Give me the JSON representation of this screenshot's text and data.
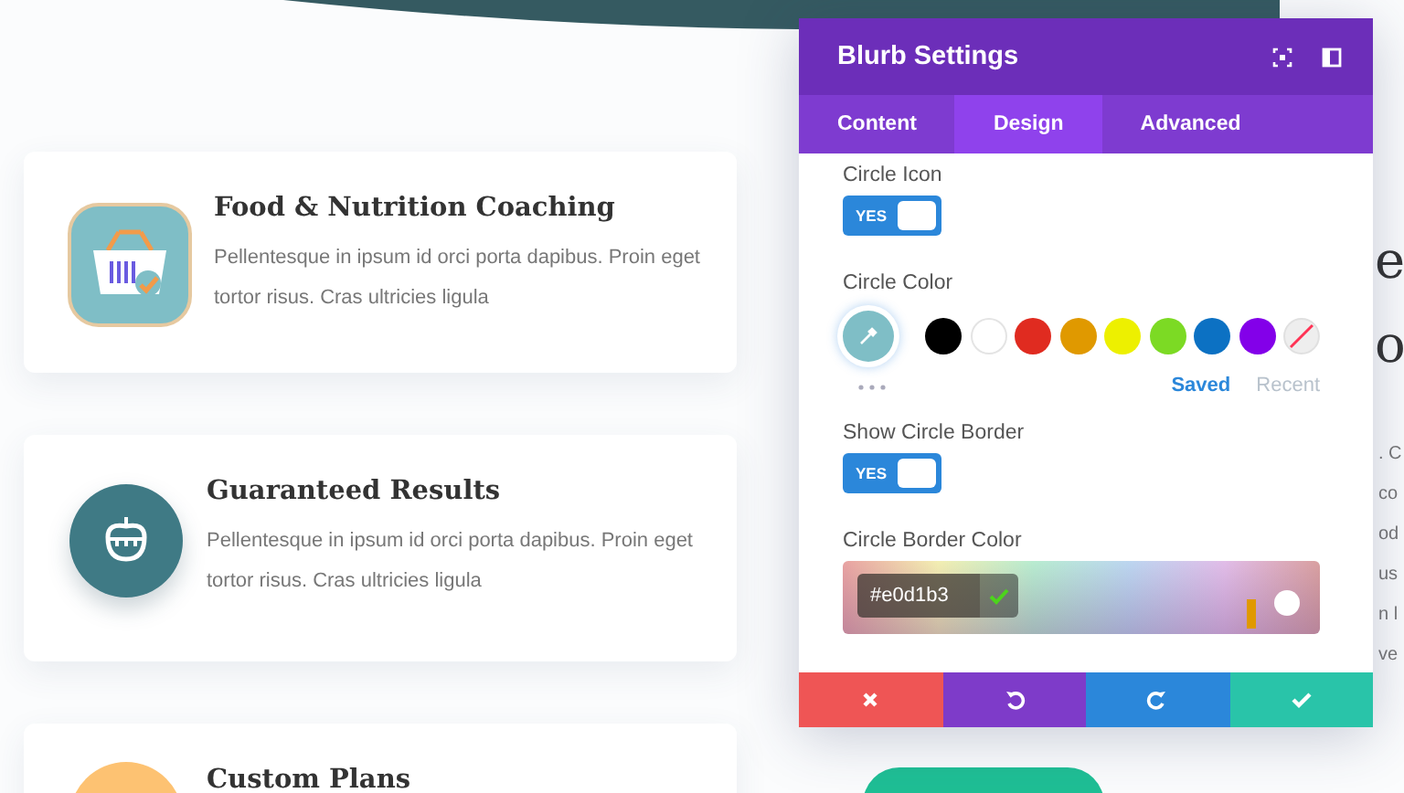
{
  "cards": [
    {
      "kind": "tile",
      "color": "#7fbec6",
      "title": "Food & Nutrition Coaching",
      "body": "Pellentesque in ipsum id orci porta dapibus. Proin eget tortor risus. Cras ultricies ligula"
    },
    {
      "kind": "badge",
      "color": "#3f7a85",
      "title": "Guaranteed Results",
      "body": "Pellentesque in ipsum id orci porta dapibus. Proin eget tortor risus. Cras ultricies ligula"
    },
    {
      "kind": "plain",
      "color": "#fdc272",
      "title": "Custom Plans"
    }
  ],
  "background_fragments": {
    "heading": [
      "e",
      "o"
    ],
    "body": [
      ". C",
      "co",
      "od",
      "us",
      "n l",
      "ve"
    ]
  },
  "panel": {
    "title": "Blurb Settings",
    "tabs": [
      {
        "label": "Content",
        "selected": false
      },
      {
        "label": "Design",
        "selected": true
      },
      {
        "label": "Advanced",
        "selected": false
      }
    ],
    "sections": [
      {
        "kind": "toggle",
        "label": "Circle Icon",
        "on": true,
        "value_label": "YES"
      },
      {
        "kind": "swatches",
        "label": "Circle Color",
        "swatches": [
          {
            "kind": "color",
            "color": "#000000"
          },
          {
            "kind": "color",
            "color": "#ffffff"
          },
          {
            "kind": "color",
            "color": "#e02b20"
          },
          {
            "kind": "color",
            "color": "#e09900"
          },
          {
            "kind": "color",
            "color": "#edf000"
          },
          {
            "kind": "color",
            "color": "#7cda24"
          },
          {
            "kind": "color",
            "color": "#0c71c3"
          },
          {
            "kind": "color",
            "color": "#8300e9"
          },
          {
            "kind": "clear"
          }
        ],
        "links": [
          {
            "label": "Saved",
            "selected": true
          },
          {
            "label": "Recent",
            "selected": false
          }
        ]
      },
      {
        "kind": "toggle",
        "label": "Show Circle Border",
        "on": true,
        "value_label": "YES"
      },
      {
        "kind": "picker",
        "label": "Circle Border Color",
        "value": "#e0d1b3"
      }
    ],
    "footer": [
      {
        "kind": "cancel",
        "color": "#ef5555"
      },
      {
        "kind": "undo",
        "color": "#7e3bc9"
      },
      {
        "kind": "redo",
        "color": "#2b87da"
      },
      {
        "kind": "save",
        "color": "#29c4a9"
      }
    ]
  }
}
